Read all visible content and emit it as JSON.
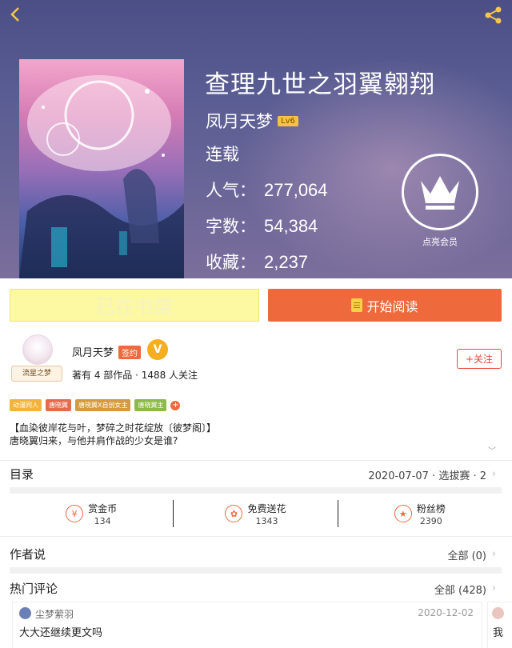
{
  "book": {
    "title": "查理九世之羽翼翱翔",
    "author": "凤月天梦",
    "author_level": "Lv6",
    "status": "连载",
    "popularity_label": "人气：",
    "popularity": "277,064",
    "words_label": "字数：",
    "words": "54,384",
    "favorites_label": "收藏：",
    "favorites": "2,237"
  },
  "vip": {
    "label": "点亮会员"
  },
  "actions": {
    "shelf_label": "已在书架",
    "read_label": "开始阅读"
  },
  "author_card": {
    "name": "凤月天梦",
    "sign_badge": "签约",
    "v_badge": "V",
    "frame_tag": "流星之梦",
    "works_text": "著有 4 部作品 · 1488 人关注",
    "follow_label": "+关注"
  },
  "tags": [
    {
      "label": "动漫同人",
      "color": "#f1b33a"
    },
    {
      "label": "唐晓翼",
      "color": "#e56a4c"
    },
    {
      "label": "唐晓翼X自创女主",
      "color": "#d59a3d"
    },
    {
      "label": "唐晓翼主",
      "color": "#8cb94a"
    }
  ],
  "tag_more": "+",
  "description": {
    "line1": "【血染彼岸花与叶，梦碎之时花绽放〔彼梦阁〕】",
    "line2": "唐晓翼归来，与他并肩作战的少女是谁?",
    "more": "﹀"
  },
  "catalog": {
    "label": "目录",
    "info": "2020-07-07 · 选拔赛 · 2"
  },
  "gifts": [
    {
      "title": "赏金币",
      "count": "134",
      "icon": "coin-icon",
      "glyph": "¥"
    },
    {
      "title": "免费送花",
      "count": "1343",
      "icon": "flower-icon",
      "glyph": "✿"
    },
    {
      "title": "粉丝榜",
      "count": "2390",
      "icon": "medal-icon",
      "glyph": "★"
    }
  ],
  "author_says": {
    "label": "作者说",
    "count_text": "全部 (0)"
  },
  "hot_comments": {
    "label": "热门评论",
    "count_text": "全部 (428)"
  },
  "comments": [
    {
      "user": "尘梦萦羽",
      "date": "2020-12-02",
      "text": "大大还继续更文吗"
    },
    {
      "text": "我"
    }
  ]
}
